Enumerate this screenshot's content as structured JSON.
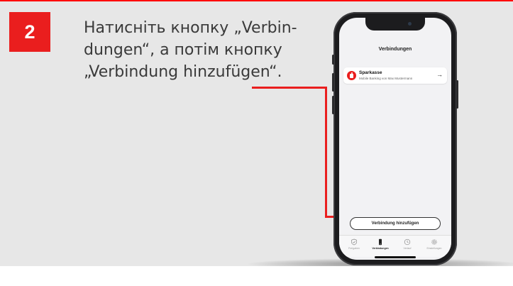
{
  "step": {
    "number": "2"
  },
  "instruction": {
    "line1": "Натисніть кнопку „Verbin-",
    "line2": "dungen“, а потім кнопку",
    "line3": "„Verbindung hinzufügen“."
  },
  "phone": {
    "screen_title": "Verbindungen",
    "connection": {
      "name": "Sparkasse",
      "subtitle": "Mobile Banking von Max Mustermann",
      "arrow": "→"
    },
    "add_button_label": "Verbindung hinzufügen",
    "tabs": [
      {
        "label": "Freigaben",
        "icon": "shield-check-icon"
      },
      {
        "label": "Verbindungen",
        "icon": "device-icon",
        "active": true
      },
      {
        "label": "Verlauf",
        "icon": "clock-icon"
      },
      {
        "label": "Einstellungen",
        "icon": "gear-icon"
      }
    ]
  },
  "colors": {
    "accent": "#ea1e1e",
    "panel": "#e7e7e7",
    "text": "#3a3a3a"
  }
}
